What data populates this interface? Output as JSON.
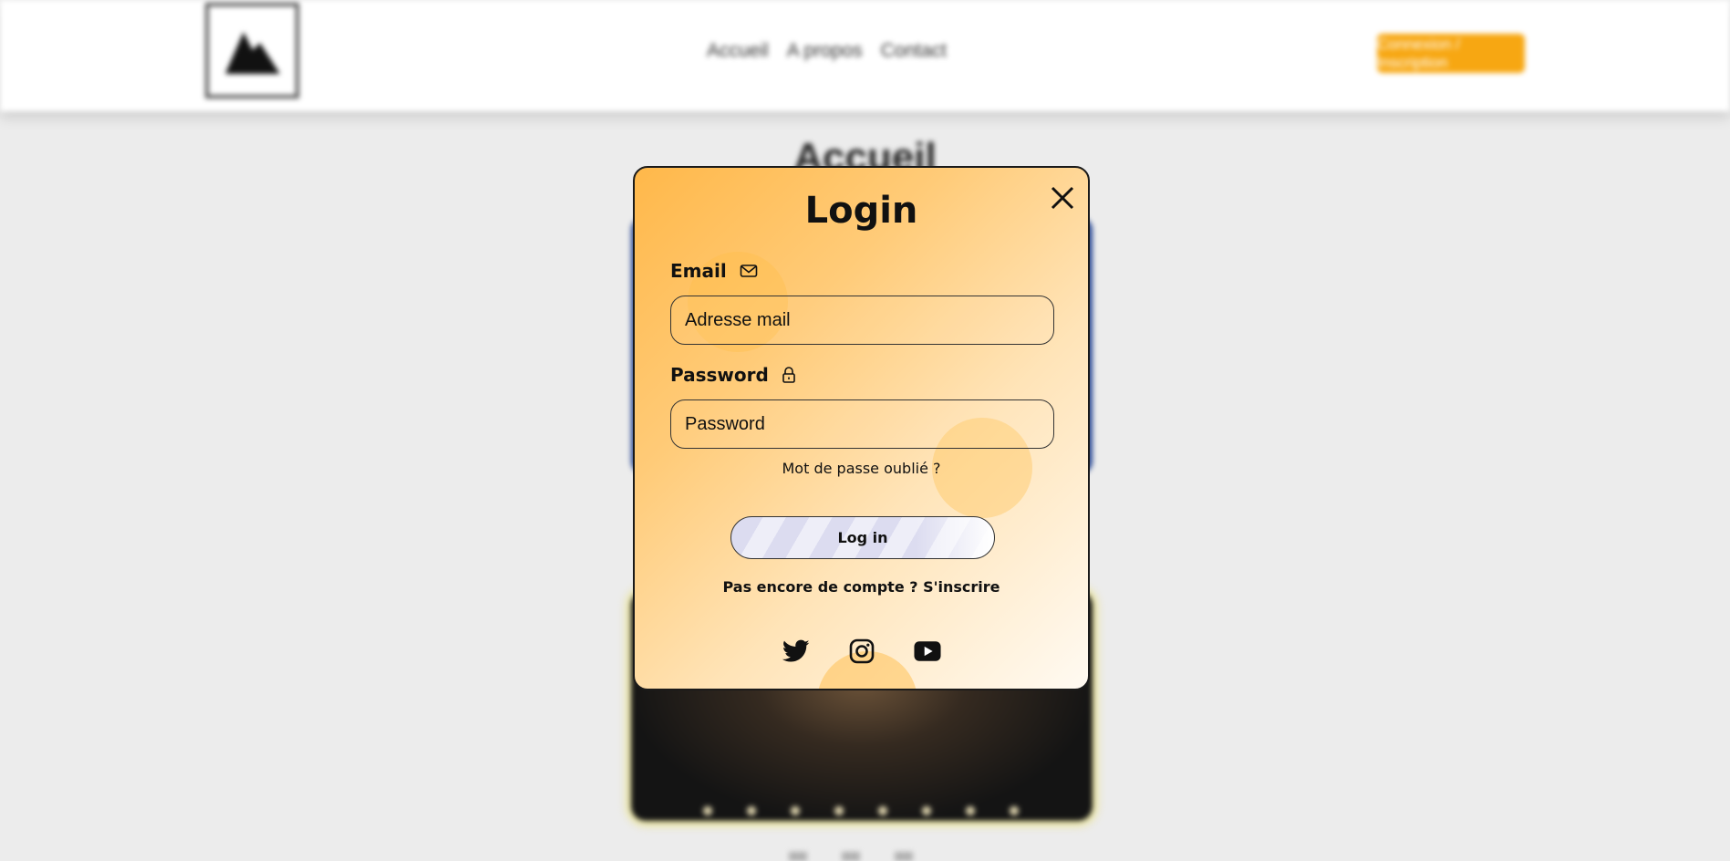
{
  "background": {
    "nav": [
      "Accueil",
      "A propos",
      "Contact"
    ],
    "cta_label": "Connexion / Inscription",
    "page_title": "Accueil"
  },
  "modal": {
    "title": "Login",
    "email": {
      "label": "Email",
      "placeholder": "Adresse mail",
      "value": ""
    },
    "password": {
      "label": "Password",
      "placeholder": "Password",
      "value": ""
    },
    "forgot_link": "Mot de passe oublié ?",
    "submit_label": "Log in",
    "signup_text": "Pas encore de compte ?",
    "signup_link": "S'inscrire",
    "socials": [
      "twitter-icon",
      "instagram-icon",
      "youtube-icon"
    ]
  },
  "colors": {
    "accent": "#f7a712",
    "modal_gradient_start": "#ffb84a",
    "modal_gradient_end": "#fffaf2",
    "text": "#111111"
  }
}
